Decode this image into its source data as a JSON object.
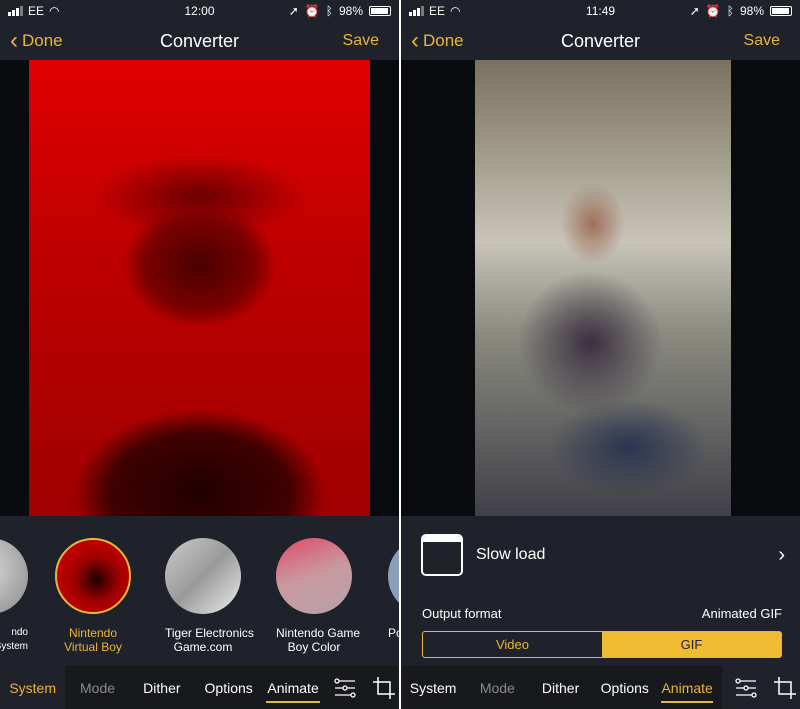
{
  "accent": "#e8b63a",
  "left": {
    "status": {
      "carrier": "EE",
      "time": "12:00",
      "battery": "98%"
    },
    "nav": {
      "back": "Done",
      "title": "Converter",
      "save": "Save"
    },
    "systems": [
      {
        "label": "ndo\nSystem"
      },
      {
        "label": "Nintendo\nVirtual Boy",
        "selected": true
      },
      {
        "label": "Tiger Electronics\nGame.com"
      },
      {
        "label": "Nintendo Game\nBoy Color"
      },
      {
        "label": "Po"
      }
    ],
    "tabs": [
      "System",
      "Mode",
      "Dither",
      "Options",
      "Animate"
    ],
    "active_tab": "System"
  },
  "right": {
    "status": {
      "carrier": "EE",
      "time": "11:49",
      "battery": "98%"
    },
    "nav": {
      "back": "Done",
      "title": "Converter",
      "save": "Save"
    },
    "animation": {
      "label": "Slow load",
      "icon": "folder-icon"
    },
    "output_format": {
      "label": "Output format",
      "value": "Animated GIF",
      "options": [
        "Video",
        "GIF"
      ],
      "selected": "GIF"
    },
    "tabs": [
      "System",
      "Mode",
      "Dither",
      "Options",
      "Animate"
    ],
    "active_tab": "Animate"
  }
}
